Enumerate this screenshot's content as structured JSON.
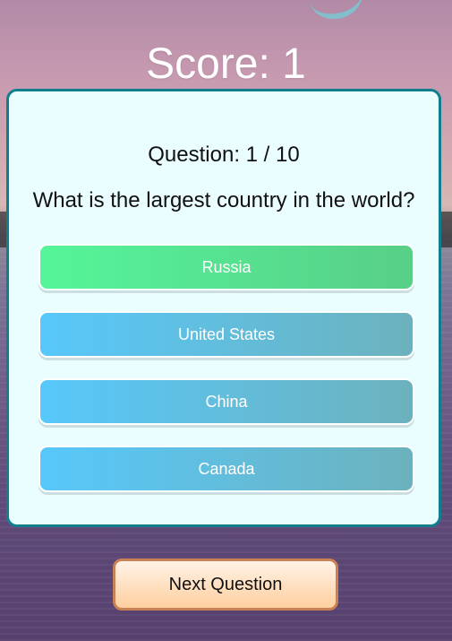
{
  "header": {
    "score_text": "Score: 1"
  },
  "quiz": {
    "question_counter": "Question: 1 / 10",
    "question": "What is the largest country in the world?",
    "answers": [
      {
        "label": "Russia",
        "state": "correct"
      },
      {
        "label": "United States",
        "state": "default"
      },
      {
        "label": "China",
        "state": "default"
      },
      {
        "label": "Canada",
        "state": "default"
      }
    ]
  },
  "footer": {
    "next_label": "Next Question"
  },
  "colors": {
    "card_border": "#0f7f90",
    "card_bg": "#eafdff",
    "answer_correct_start": "#55f59a",
    "answer_correct_end": "#58cf87",
    "answer_default_start": "#57c8fb",
    "answer_default_end": "#6cb2bd",
    "next_border": "#c98055",
    "next_bg_top": "#fff3e7",
    "next_bg_bottom": "#ffcf9f"
  }
}
